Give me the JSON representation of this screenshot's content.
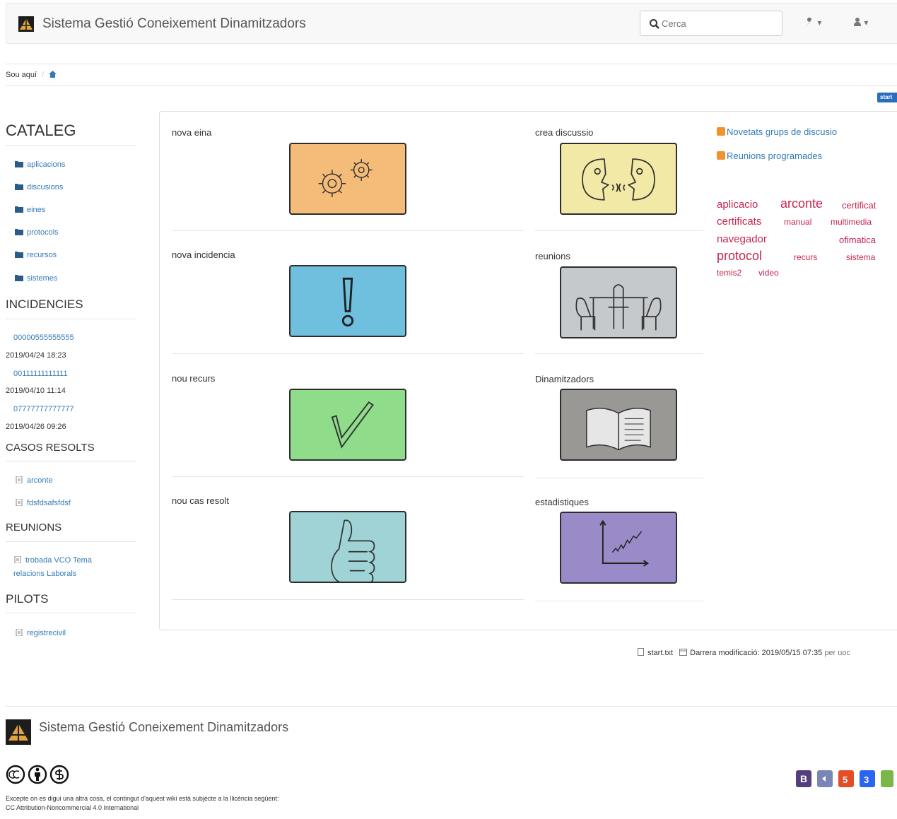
{
  "header": {
    "title": "Sistema Gestió Coneixement Dinamitzadors",
    "search_placeholder": "Cerca",
    "tools_caret": "▾",
    "user_caret": "▾"
  },
  "breadcrumb": {
    "label": "Sou aquí",
    "separator": "/"
  },
  "start_badge": "start",
  "sidebar": {
    "cataleg": {
      "heading": "CATALEG",
      "items": [
        "aplicacions",
        "discusions",
        "eines",
        "protocols",
        "recursos",
        "sistemes"
      ]
    },
    "incidencies": {
      "heading": "INCIDENCIES",
      "items": [
        {
          "id": "00000555555555",
          "date": "2019/04/24 18:23"
        },
        {
          "id": "00111111111111",
          "date": "2019/04/10 11:14"
        },
        {
          "id": "07777777777777",
          "date": "2019/04/26 09:26"
        }
      ]
    },
    "casos": {
      "heading": "CASOS RESOLTS",
      "items": [
        "arconte",
        "fdsfdsafsfdsf"
      ]
    },
    "reunions": {
      "heading": "REUNIONS",
      "items": [
        "trobada VCO Tema relacions Laborals"
      ]
    },
    "pilots": {
      "heading": "PILOTS",
      "items": [
        "registrecivil"
      ]
    }
  },
  "tiles": [
    {
      "label": "nova eina",
      "icon": "gears-icon",
      "color": "#f4bc78"
    },
    {
      "label": "crea discussio",
      "icon": "faces-talking-icon",
      "color": "#f3e9a6"
    },
    {
      "label": "nova incidencia",
      "icon": "exclamation-icon",
      "color": "#6fbfdf"
    },
    {
      "label": "reunions",
      "icon": "meeting-table-icon",
      "color": "#c5c9cc"
    },
    {
      "label": "nou recurs",
      "icon": "checkmark-icon",
      "color": "#8fdc8a"
    },
    {
      "label": "Dinamitzadors",
      "icon": "open-book-icon",
      "color": "#9a9895"
    },
    {
      "label": "nou cas resolt",
      "icon": "thumbs-up-icon",
      "color": "#9fd3d6"
    },
    {
      "label": "estadistiques",
      "icon": "chart-icon",
      "color": "#9a8bc8"
    }
  ],
  "feeds": [
    "Novetats grups de discusio",
    "Reunions programades"
  ],
  "tags": [
    "aplicacio",
    "arconte",
    "certificat",
    "certificats",
    "manual",
    "multimedia",
    "navegador",
    "ofimatica",
    "protocol",
    "recurs",
    "sistema",
    "temis2",
    "video"
  ],
  "page_info": {
    "file": "start.txt",
    "modified_label": "Darrera modificació:",
    "modified": "2019/05/15 07:35",
    "by": "per uoc"
  },
  "footer": {
    "title": "Sistema Gestió Coneixement Dinamitzadors",
    "license_line1": "Excepte on es digui una altra cosa, el contingut d'aquest wiki està subjecte a la llicència següent:",
    "license_line2": "CC Attribution-Noncommercial 4.0 International"
  }
}
